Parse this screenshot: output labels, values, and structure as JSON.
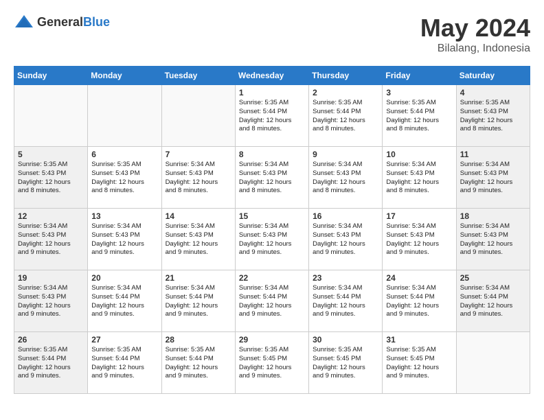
{
  "header": {
    "logo_general": "General",
    "logo_blue": "Blue",
    "month_year": "May 2024",
    "location": "Bilalang, Indonesia"
  },
  "weekdays": [
    "Sunday",
    "Monday",
    "Tuesday",
    "Wednesday",
    "Thursday",
    "Friday",
    "Saturday"
  ],
  "weeks": [
    [
      {
        "day": "",
        "info": "",
        "empty": true
      },
      {
        "day": "",
        "info": "",
        "empty": true
      },
      {
        "day": "",
        "info": "",
        "empty": true
      },
      {
        "day": "1",
        "info": "Sunrise: 5:35 AM\nSunset: 5:44 PM\nDaylight: 12 hours\nand 8 minutes."
      },
      {
        "day": "2",
        "info": "Sunrise: 5:35 AM\nSunset: 5:44 PM\nDaylight: 12 hours\nand 8 minutes."
      },
      {
        "day": "3",
        "info": "Sunrise: 5:35 AM\nSunset: 5:44 PM\nDaylight: 12 hours\nand 8 minutes."
      },
      {
        "day": "4",
        "info": "Sunrise: 5:35 AM\nSunset: 5:43 PM\nDaylight: 12 hours\nand 8 minutes."
      }
    ],
    [
      {
        "day": "5",
        "info": "Sunrise: 5:35 AM\nSunset: 5:43 PM\nDaylight: 12 hours\nand 8 minutes."
      },
      {
        "day": "6",
        "info": "Sunrise: 5:35 AM\nSunset: 5:43 PM\nDaylight: 12 hours\nand 8 minutes."
      },
      {
        "day": "7",
        "info": "Sunrise: 5:34 AM\nSunset: 5:43 PM\nDaylight: 12 hours\nand 8 minutes."
      },
      {
        "day": "8",
        "info": "Sunrise: 5:34 AM\nSunset: 5:43 PM\nDaylight: 12 hours\nand 8 minutes."
      },
      {
        "day": "9",
        "info": "Sunrise: 5:34 AM\nSunset: 5:43 PM\nDaylight: 12 hours\nand 8 minutes."
      },
      {
        "day": "10",
        "info": "Sunrise: 5:34 AM\nSunset: 5:43 PM\nDaylight: 12 hours\nand 8 minutes."
      },
      {
        "day": "11",
        "info": "Sunrise: 5:34 AM\nSunset: 5:43 PM\nDaylight: 12 hours\nand 9 minutes."
      }
    ],
    [
      {
        "day": "12",
        "info": "Sunrise: 5:34 AM\nSunset: 5:43 PM\nDaylight: 12 hours\nand 9 minutes."
      },
      {
        "day": "13",
        "info": "Sunrise: 5:34 AM\nSunset: 5:43 PM\nDaylight: 12 hours\nand 9 minutes."
      },
      {
        "day": "14",
        "info": "Sunrise: 5:34 AM\nSunset: 5:43 PM\nDaylight: 12 hours\nand 9 minutes."
      },
      {
        "day": "15",
        "info": "Sunrise: 5:34 AM\nSunset: 5:43 PM\nDaylight: 12 hours\nand 9 minutes."
      },
      {
        "day": "16",
        "info": "Sunrise: 5:34 AM\nSunset: 5:43 PM\nDaylight: 12 hours\nand 9 minutes."
      },
      {
        "day": "17",
        "info": "Sunrise: 5:34 AM\nSunset: 5:43 PM\nDaylight: 12 hours\nand 9 minutes."
      },
      {
        "day": "18",
        "info": "Sunrise: 5:34 AM\nSunset: 5:43 PM\nDaylight: 12 hours\nand 9 minutes."
      }
    ],
    [
      {
        "day": "19",
        "info": "Sunrise: 5:34 AM\nSunset: 5:43 PM\nDaylight: 12 hours\nand 9 minutes."
      },
      {
        "day": "20",
        "info": "Sunrise: 5:34 AM\nSunset: 5:44 PM\nDaylight: 12 hours\nand 9 minutes."
      },
      {
        "day": "21",
        "info": "Sunrise: 5:34 AM\nSunset: 5:44 PM\nDaylight: 12 hours\nand 9 minutes."
      },
      {
        "day": "22",
        "info": "Sunrise: 5:34 AM\nSunset: 5:44 PM\nDaylight: 12 hours\nand 9 minutes."
      },
      {
        "day": "23",
        "info": "Sunrise: 5:34 AM\nSunset: 5:44 PM\nDaylight: 12 hours\nand 9 minutes."
      },
      {
        "day": "24",
        "info": "Sunrise: 5:34 AM\nSunset: 5:44 PM\nDaylight: 12 hours\nand 9 minutes."
      },
      {
        "day": "25",
        "info": "Sunrise: 5:34 AM\nSunset: 5:44 PM\nDaylight: 12 hours\nand 9 minutes."
      }
    ],
    [
      {
        "day": "26",
        "info": "Sunrise: 5:35 AM\nSunset: 5:44 PM\nDaylight: 12 hours\nand 9 minutes."
      },
      {
        "day": "27",
        "info": "Sunrise: 5:35 AM\nSunset: 5:44 PM\nDaylight: 12 hours\nand 9 minutes."
      },
      {
        "day": "28",
        "info": "Sunrise: 5:35 AM\nSunset: 5:44 PM\nDaylight: 12 hours\nand 9 minutes."
      },
      {
        "day": "29",
        "info": "Sunrise: 5:35 AM\nSunset: 5:45 PM\nDaylight: 12 hours\nand 9 minutes."
      },
      {
        "day": "30",
        "info": "Sunrise: 5:35 AM\nSunset: 5:45 PM\nDaylight: 12 hours\nand 9 minutes."
      },
      {
        "day": "31",
        "info": "Sunrise: 5:35 AM\nSunset: 5:45 PM\nDaylight: 12 hours\nand 9 minutes."
      },
      {
        "day": "",
        "info": "",
        "empty": true
      }
    ]
  ]
}
